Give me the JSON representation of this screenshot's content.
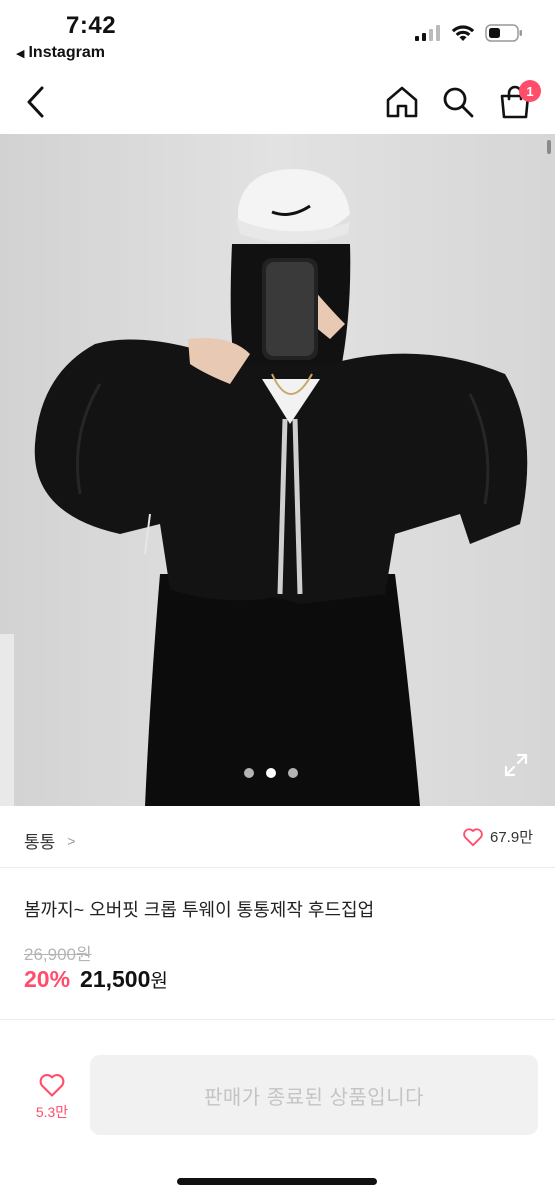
{
  "status_bar": {
    "time": "7:42",
    "back_app": "Instagram"
  },
  "nav": {
    "cart_badge": "1"
  },
  "gallery": {
    "page_count": 3,
    "active_index": 1
  },
  "shop": {
    "name": "통통",
    "like_count": "67.9만"
  },
  "product": {
    "title": "봄까지~ 오버핏 크롭 투웨이 통통제작 후드집업",
    "original_price": "26,900원",
    "discount": "20%",
    "price": "21,500",
    "currency": "원"
  },
  "bottom": {
    "wish_count": "5.3만",
    "sold_out_label": "판매가 종료된 상품입니다"
  },
  "colors": {
    "accent": "#ff4d6a",
    "disabled_bg": "#f1f1f1",
    "disabled_text": "#c4c4c4"
  }
}
